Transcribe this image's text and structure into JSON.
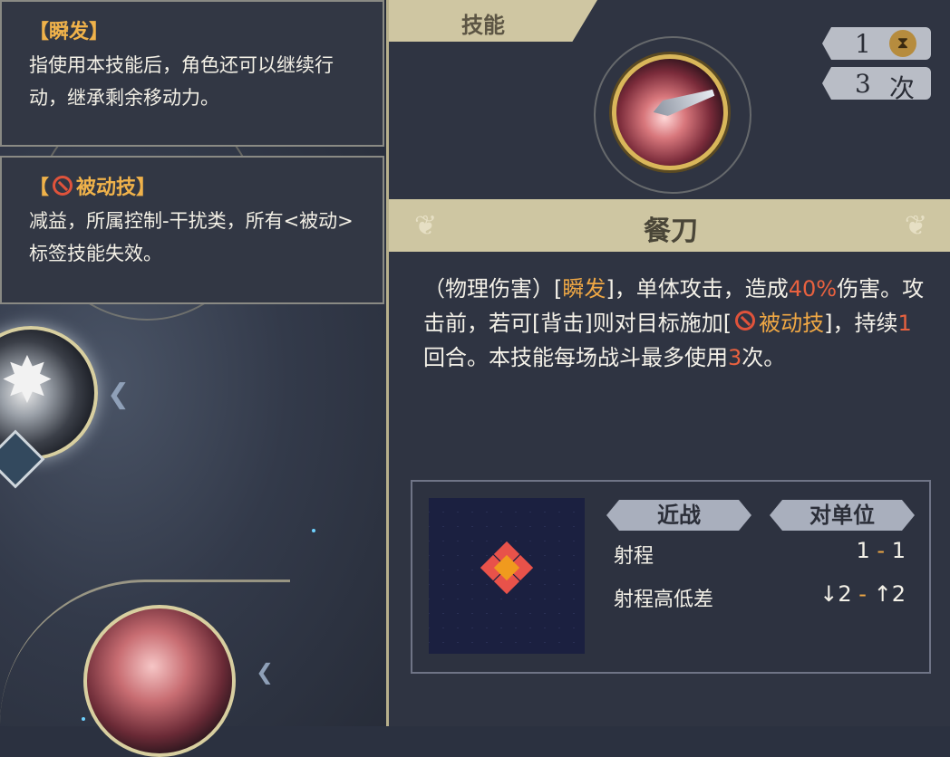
{
  "passive_tip_1": {
    "title": "【瞬发】",
    "text": "指使用本技能后，角色还可以继续行动，继承剩余移动力。"
  },
  "passive_tip_2": {
    "title_open": "【",
    "title_main": "被动技",
    "title_close": "】",
    "title_icon": "ban-icon",
    "text": "减益，所属控制-干扰类，所有<被动>标签技能失效。"
  },
  "skill": {
    "tab": "技能",
    "cooldown_value": "1",
    "cooldown_icon": "hourglass-icon",
    "uses_value": "3",
    "uses_unit": "次",
    "name": "餐刀",
    "description": {
      "p1": "（物理伤害）[",
      "k1": "瞬发",
      "p2": "]，单体攻击，造成",
      "v1": "40%",
      "p3": "伤害。攻击前，若可[背击]则对目标施加[",
      "k2": "被动技",
      "p4": "]，持续",
      "v2": "1",
      "p5": "回合。本技能每场战斗最多使用",
      "v3": "3",
      "p6": "次。"
    }
  },
  "range_info": {
    "tag_attack": "近战",
    "tag_target": "对单位",
    "range_label": "射程",
    "range_min": "1",
    "range_sep": "-",
    "range_max": "1",
    "height_label": "射程高低差",
    "height_down": "↓2",
    "height_sep": "-",
    "height_up": "↑2"
  },
  "colors": {
    "highlight_orange": "#f0a844",
    "highlight_red": "#e8613f",
    "tile_red": "#e8524a",
    "tile_orange": "#f09a1e"
  }
}
